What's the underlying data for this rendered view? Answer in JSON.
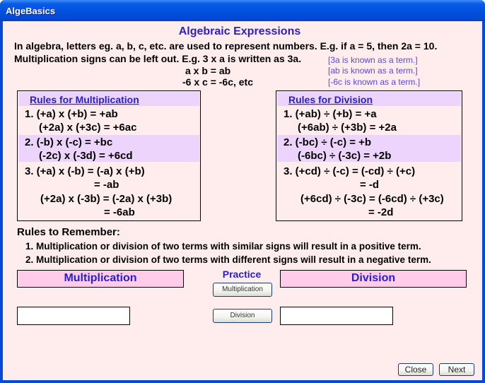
{
  "window": {
    "title": "AlgeBasics"
  },
  "page": {
    "title": "Algebraic Expressions",
    "intro_line1": "In algebra, letters eg. a, b, c, etc. are used to represent numbers. E.g. if a = 5, then 2a = 10.",
    "intro_line2": "Multiplication signs can be left out. E.g. 3 x a is written as 3a.",
    "example1": "a x b = ab",
    "example2": "-6 x c = -6c, etc",
    "notes": [
      "[3a is known as a term.]",
      "[ab is known as a term.]",
      "[-6c is known as a term.]"
    ]
  },
  "multiplication_rules": {
    "header": "Rules for Multiplication",
    "rule1": [
      "1.  (+a)   x  (+b)  = +ab",
      "(+2a) x (+3c) = +6ac"
    ],
    "rule2": [
      "2.  (-b)  x  (-c)   = +bc",
      "(-2c) x (-3d) = +6cd"
    ],
    "rule3": [
      "3.  (+a) x (-b) = (-a) x (+b)",
      "= -ab",
      "(+2a) x (-3b) = (-2a) x (+3b)",
      "= -6ab"
    ]
  },
  "division_rules": {
    "header": "Rules for Division",
    "rule1": [
      "1.  (+ab)  ÷  (+b)   = +a",
      "(+6ab) ÷ (+3b) = +2a"
    ],
    "rule2": [
      "2.  (-bc)  ÷  (-c)   = +b",
      "(-6bc) ÷ (-3c) = +2b"
    ],
    "rule3": [
      "3.  (+cd) ÷ (-c) = (-cd) ÷ (+c)",
      "= -d",
      "(+6cd) ÷ (-3c) = (-6cd) ÷ (+3c)",
      "= -2d"
    ]
  },
  "remember": {
    "title": "Rules to Remember:",
    "items": [
      "1.  Multiplication or division of two terms with similar signs will result in a positive term.",
      "2.  Multiplication or division of two terms with different signs will result in a negative term."
    ]
  },
  "practice": {
    "title": "Practice",
    "multiplication_label": "Multiplication",
    "division_label": "Division",
    "multiplication_button": "Multiplication",
    "division_button": "Division",
    "multiplication_input_value": "",
    "division_input_value": ""
  },
  "footer": {
    "close_label": "Close",
    "next_label": "Next"
  }
}
